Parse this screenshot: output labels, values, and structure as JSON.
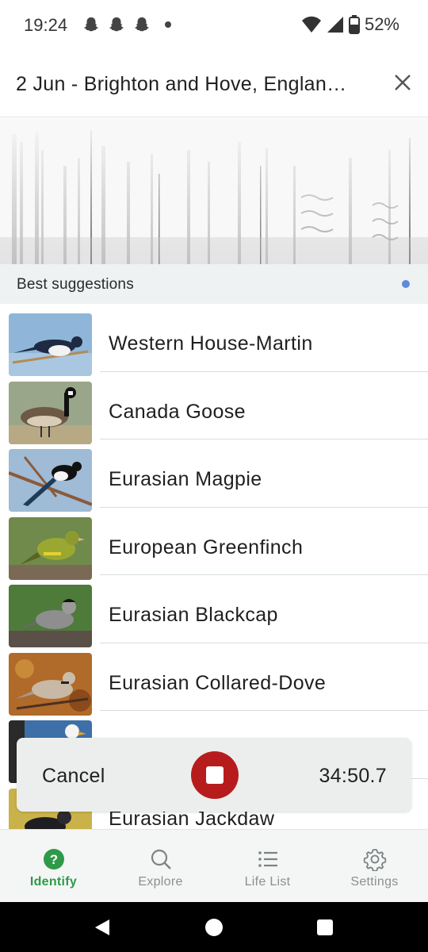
{
  "status_bar": {
    "time": "19:24",
    "battery": "52%",
    "icons": [
      "snapchat-icon",
      "snapchat-icon",
      "snapchat-icon",
      "notification-dot",
      "wifi-icon",
      "signal-icon",
      "battery-icon"
    ]
  },
  "header": {
    "title": "2 Jun - Brighton and Hove, Englan…",
    "close_icon": "close-icon"
  },
  "suggestions": {
    "heading": "Best suggestions",
    "indicator_color": "#5b8bd9",
    "items": [
      {
        "name": "Western House-Martin"
      },
      {
        "name": "Canada Goose"
      },
      {
        "name": "Eurasian Magpie"
      },
      {
        "name": "European Greenfinch"
      },
      {
        "name": "Eurasian Blackcap"
      },
      {
        "name": "Eurasian Collared-Dove"
      },
      {
        "name": ""
      },
      {
        "name": "Eurasian Jackdaw"
      }
    ]
  },
  "recording": {
    "cancel_label": "Cancel",
    "timer": "34:50.7",
    "stop_color": "#b71c1c"
  },
  "bottom_nav": {
    "items": [
      {
        "label": "Identify",
        "icon": "question-circle-icon",
        "active": true
      },
      {
        "label": "Explore",
        "icon": "search-icon",
        "active": false
      },
      {
        "label": "Life List",
        "icon": "list-icon",
        "active": false
      },
      {
        "label": "Settings",
        "icon": "gear-icon",
        "active": false
      }
    ],
    "active_color": "#2e9a48"
  },
  "system_nav": {
    "icons": [
      "back-icon",
      "home-icon",
      "recents-icon"
    ]
  }
}
